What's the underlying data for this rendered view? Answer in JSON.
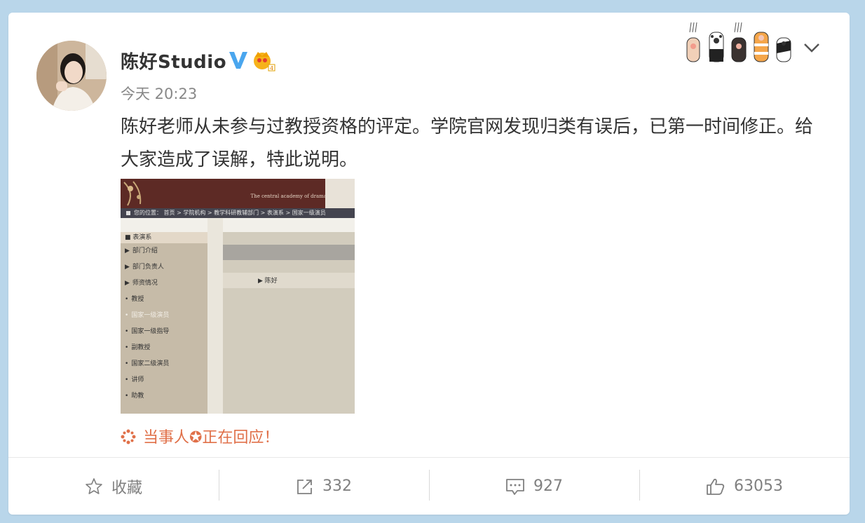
{
  "post": {
    "username": "陈好Studio",
    "time": "今天 20:23",
    "text": "陈好老师从未参与过教授资格的评定。学院官网发现归类有误后，已第一时间修正。给大家造成了误解，特此说明。",
    "reply_text": "当事人✪正在回应！"
  },
  "image": {
    "banner_text": "The central academy of drama",
    "breadcrumb": "您的位置： 首页 > 学院机构 > 教学科研教辅部门 > 表演系 > 国家一级演员",
    "menu_header": "表演系",
    "menu_items": [
      {
        "label": "部门介绍",
        "bullet": "▶"
      },
      {
        "label": "部门负责人",
        "bullet": "▶"
      },
      {
        "label": "师资情况",
        "bullet": "▶"
      },
      {
        "label": "教授",
        "bullet": "•"
      },
      {
        "label": "国家一级演员",
        "bullet": "•"
      },
      {
        "label": "国家一级指导",
        "bullet": "•"
      },
      {
        "label": "副教授",
        "bullet": "•"
      },
      {
        "label": "国家二级演员",
        "bullet": "•"
      },
      {
        "label": "讲师",
        "bullet": "•"
      },
      {
        "label": "助教",
        "bullet": "•"
      }
    ],
    "person_name": "陈好"
  },
  "actions": {
    "favorite_label": "收藏",
    "repost_count": "332",
    "comment_count": "927",
    "like_count": "63053"
  },
  "colors": {
    "background": "#b9d6ea",
    "reply": "#e07049",
    "verified": "#4aa6ee"
  }
}
